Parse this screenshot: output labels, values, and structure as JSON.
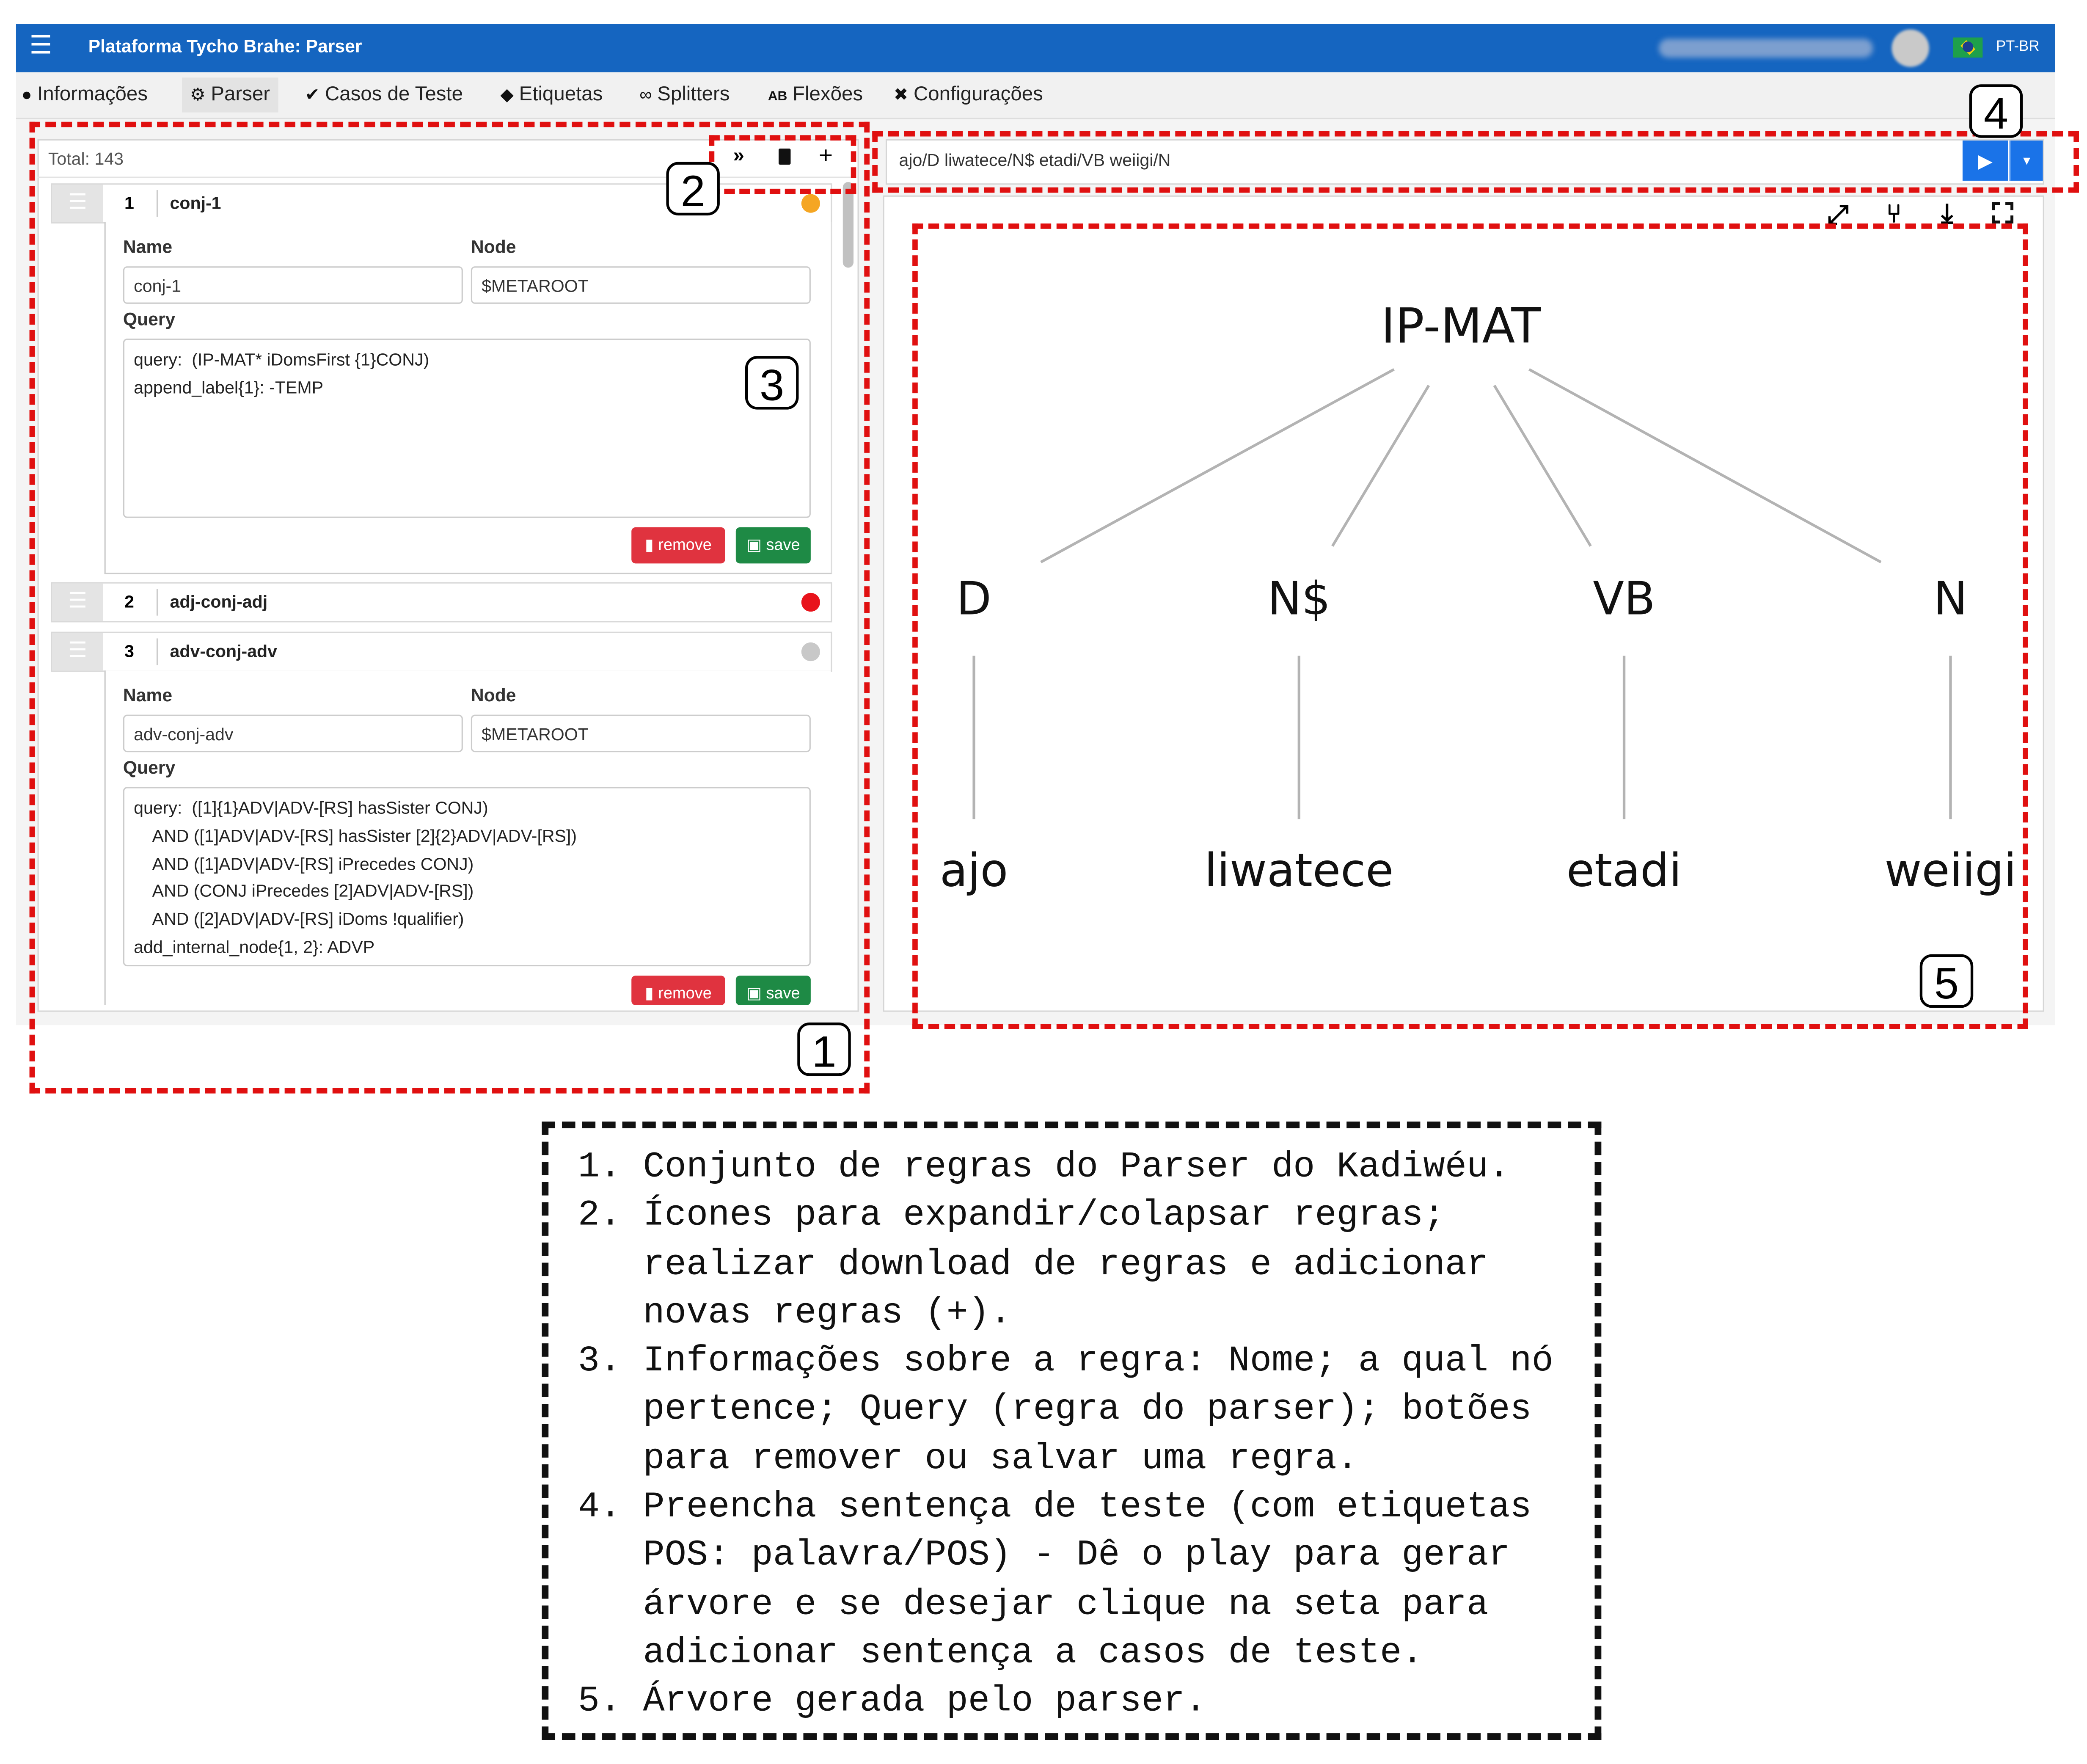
{
  "topbar": {
    "menu_icon": "menu-icon",
    "title": "Plataforma Tycho Brahe: Parser",
    "language": "PT-BR"
  },
  "tabs": [
    {
      "label": "Informações",
      "icon": "info-icon"
    },
    {
      "label": "Parser",
      "icon": "gears-icon"
    },
    {
      "label": "Casos de Teste",
      "icon": "check-circle-icon"
    },
    {
      "label": "Etiquetas",
      "icon": "tags-icon"
    },
    {
      "label": "Splitters",
      "icon": "link-icon"
    },
    {
      "label": "Flexões",
      "icon": "spell-check-icon"
    },
    {
      "label": "Configurações",
      "icon": "tools-icon"
    }
  ],
  "rules_panel": {
    "total": "Total: 143",
    "toolbar_icons": [
      "expand-collapse-icon",
      "download-icon",
      "add-icon"
    ],
    "add_label": "+",
    "field_labels": {
      "name": "Name",
      "node": "Node",
      "query": "Query"
    },
    "buttons": {
      "remove": "remove",
      "save": "save"
    },
    "rules": [
      {
        "number": "1",
        "name": "conj-1",
        "status_color": "#f5a623",
        "name_value": "conj-1",
        "node_value": "$METAROOT",
        "query_lines": [
          "query:  (IP-MAT* iDomsFirst {1}CONJ)",
          "append_label{1}: -TEMP"
        ]
      },
      {
        "number": "2",
        "name": "adj-conj-adj",
        "status_color": "#e8131b"
      },
      {
        "number": "3",
        "name": "adv-conj-adv",
        "status_color": "#c8c8c8",
        "name_value": "adv-conj-adv",
        "node_value": "$METAROOT",
        "query_lines": [
          "query:  ([1]{1}ADV|ADV-[RS] hasSister CONJ)",
          "    AND ([1]ADV|ADV-[RS] hasSister [2]{2}ADV|ADV-[RS])",
          "    AND ([1]ADV|ADV-[RS] iPrecedes CONJ)",
          "    AND (CONJ iPrecedes [2]ADV|ADV-[RS])",
          "    AND ([2]ADV|ADV-[RS] iDoms !qualifier)",
          "add_internal_node{1, 2}: ADVP"
        ]
      }
    ]
  },
  "sentence_bar": {
    "value": "ajo/D liwatece/N$ etadi/VB weiigi/N",
    "play_icon": "play-icon",
    "dropdown_icon": "caret-down-icon"
  },
  "tree_panel": {
    "toolbar_icons": [
      "expand-arrows-icon",
      "tree-icon",
      "download-icon",
      "fullscreen-icon"
    ],
    "root": "IP-MAT",
    "tags": [
      "D",
      "N$",
      "VB",
      "N"
    ],
    "words": [
      "ajo",
      "liwatece",
      "etadi",
      "weiigi"
    ]
  },
  "callouts": [
    "1",
    "2",
    "3",
    "4",
    "5"
  ],
  "legend": {
    "items": [
      "1. Conjunto de regras do Parser do Kadiwéu.",
      "2. Ícones para expandir/colapsar regras;",
      "   realizar download de regras e adicionar",
      "   novas regras (+).",
      "3. Informações sobre a regra: Nome; a qual nó",
      "   pertence; Query (regra do parser); botões",
      "   para remover ou salvar uma regra.",
      "4. Preencha sentença de teste (com etiquetas",
      "   POS: palavra/POS) - Dê o play para gerar",
      "   árvore e se desejar clique na seta para",
      "   adicionar sentença a casos de teste.",
      "5. Árvore gerada pelo parser."
    ]
  },
  "colors": {
    "topbar": "#1565c0",
    "annotation_red": "#e01010",
    "remove": "#e0333f",
    "save": "#1e8a45",
    "play": "#1a73e8"
  }
}
